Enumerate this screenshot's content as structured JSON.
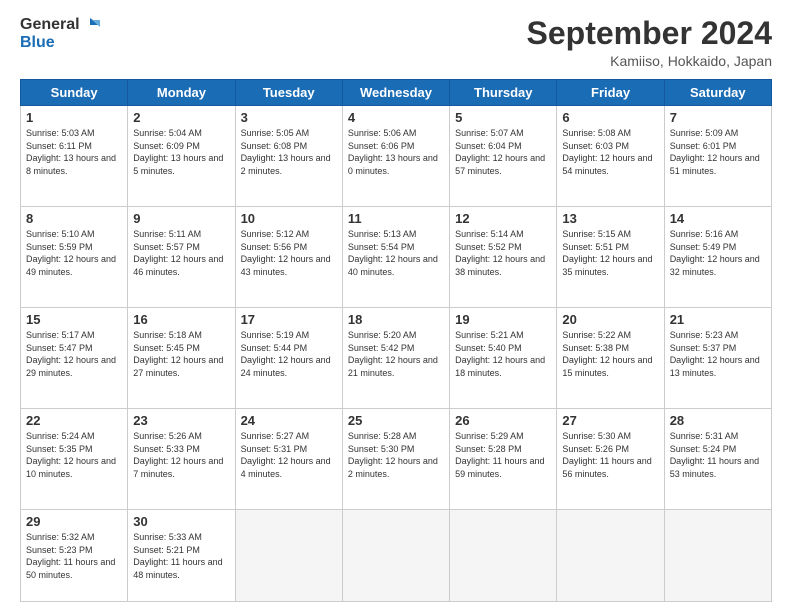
{
  "logo": {
    "text_general": "General",
    "text_blue": "Blue"
  },
  "header": {
    "month": "September 2024",
    "location": "Kamiiso, Hokkaido, Japan"
  },
  "weekdays": [
    "Sunday",
    "Monday",
    "Tuesday",
    "Wednesday",
    "Thursday",
    "Friday",
    "Saturday"
  ],
  "weeks": [
    [
      {
        "day": "1",
        "sunrise": "5:03 AM",
        "sunset": "6:11 PM",
        "daylight": "13 hours and 8 minutes."
      },
      {
        "day": "2",
        "sunrise": "5:04 AM",
        "sunset": "6:09 PM",
        "daylight": "13 hours and 5 minutes."
      },
      {
        "day": "3",
        "sunrise": "5:05 AM",
        "sunset": "6:08 PM",
        "daylight": "13 hours and 2 minutes."
      },
      {
        "day": "4",
        "sunrise": "5:06 AM",
        "sunset": "6:06 PM",
        "daylight": "13 hours and 0 minutes."
      },
      {
        "day": "5",
        "sunrise": "5:07 AM",
        "sunset": "6:04 PM",
        "daylight": "12 hours and 57 minutes."
      },
      {
        "day": "6",
        "sunrise": "5:08 AM",
        "sunset": "6:03 PM",
        "daylight": "12 hours and 54 minutes."
      },
      {
        "day": "7",
        "sunrise": "5:09 AM",
        "sunset": "6:01 PM",
        "daylight": "12 hours and 51 minutes."
      }
    ],
    [
      {
        "day": "8",
        "sunrise": "5:10 AM",
        "sunset": "5:59 PM",
        "daylight": "12 hours and 49 minutes."
      },
      {
        "day": "9",
        "sunrise": "5:11 AM",
        "sunset": "5:57 PM",
        "daylight": "12 hours and 46 minutes."
      },
      {
        "day": "10",
        "sunrise": "5:12 AM",
        "sunset": "5:56 PM",
        "daylight": "12 hours and 43 minutes."
      },
      {
        "day": "11",
        "sunrise": "5:13 AM",
        "sunset": "5:54 PM",
        "daylight": "12 hours and 40 minutes."
      },
      {
        "day": "12",
        "sunrise": "5:14 AM",
        "sunset": "5:52 PM",
        "daylight": "12 hours and 38 minutes."
      },
      {
        "day": "13",
        "sunrise": "5:15 AM",
        "sunset": "5:51 PM",
        "daylight": "12 hours and 35 minutes."
      },
      {
        "day": "14",
        "sunrise": "5:16 AM",
        "sunset": "5:49 PM",
        "daylight": "12 hours and 32 minutes."
      }
    ],
    [
      {
        "day": "15",
        "sunrise": "5:17 AM",
        "sunset": "5:47 PM",
        "daylight": "12 hours and 29 minutes."
      },
      {
        "day": "16",
        "sunrise": "5:18 AM",
        "sunset": "5:45 PM",
        "daylight": "12 hours and 27 minutes."
      },
      {
        "day": "17",
        "sunrise": "5:19 AM",
        "sunset": "5:44 PM",
        "daylight": "12 hours and 24 minutes."
      },
      {
        "day": "18",
        "sunrise": "5:20 AM",
        "sunset": "5:42 PM",
        "daylight": "12 hours and 21 minutes."
      },
      {
        "day": "19",
        "sunrise": "5:21 AM",
        "sunset": "5:40 PM",
        "daylight": "12 hours and 18 minutes."
      },
      {
        "day": "20",
        "sunrise": "5:22 AM",
        "sunset": "5:38 PM",
        "daylight": "12 hours and 15 minutes."
      },
      {
        "day": "21",
        "sunrise": "5:23 AM",
        "sunset": "5:37 PM",
        "daylight": "12 hours and 13 minutes."
      }
    ],
    [
      {
        "day": "22",
        "sunrise": "5:24 AM",
        "sunset": "5:35 PM",
        "daylight": "12 hours and 10 minutes."
      },
      {
        "day": "23",
        "sunrise": "5:26 AM",
        "sunset": "5:33 PM",
        "daylight": "12 hours and 7 minutes."
      },
      {
        "day": "24",
        "sunrise": "5:27 AM",
        "sunset": "5:31 PM",
        "daylight": "12 hours and 4 minutes."
      },
      {
        "day": "25",
        "sunrise": "5:28 AM",
        "sunset": "5:30 PM",
        "daylight": "12 hours and 2 minutes."
      },
      {
        "day": "26",
        "sunrise": "5:29 AM",
        "sunset": "5:28 PM",
        "daylight": "11 hours and 59 minutes."
      },
      {
        "day": "27",
        "sunrise": "5:30 AM",
        "sunset": "5:26 PM",
        "daylight": "11 hours and 56 minutes."
      },
      {
        "day": "28",
        "sunrise": "5:31 AM",
        "sunset": "5:24 PM",
        "daylight": "11 hours and 53 minutes."
      }
    ],
    [
      {
        "day": "29",
        "sunrise": "5:32 AM",
        "sunset": "5:23 PM",
        "daylight": "11 hours and 50 minutes."
      },
      {
        "day": "30",
        "sunrise": "5:33 AM",
        "sunset": "5:21 PM",
        "daylight": "11 hours and 48 minutes."
      },
      null,
      null,
      null,
      null,
      null
    ]
  ]
}
